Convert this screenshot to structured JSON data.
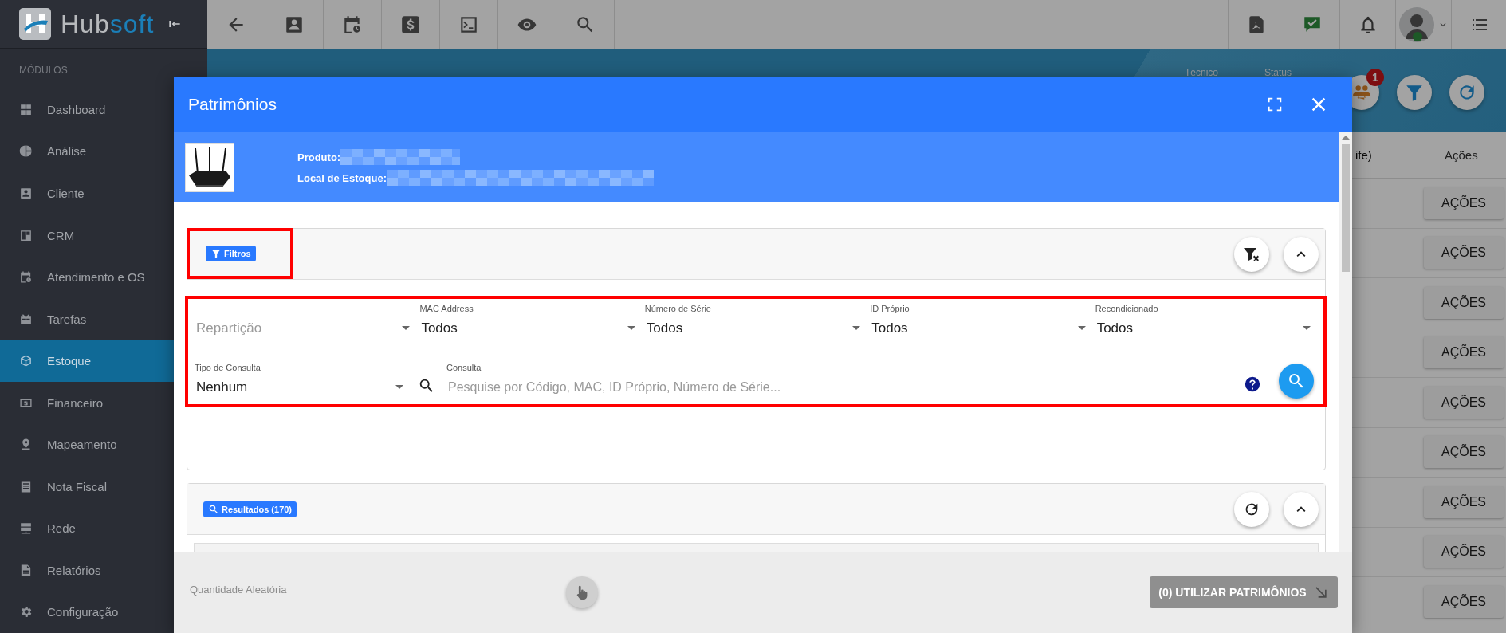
{
  "sidebar": {
    "brand": [
      "Hub",
      "soft"
    ],
    "section": "MÓDULOS",
    "items": [
      {
        "label": "Dashboard",
        "selected": false
      },
      {
        "label": "Análise",
        "selected": false
      },
      {
        "label": "Cliente",
        "selected": false
      },
      {
        "label": "CRM",
        "selected": false
      },
      {
        "label": "Atendimento e OS",
        "selected": false
      },
      {
        "label": "Tarefas",
        "selected": false
      },
      {
        "label": "Estoque",
        "selected": true
      },
      {
        "label": "Financeiro",
        "selected": false
      },
      {
        "label": "Mapeamento",
        "selected": false
      },
      {
        "label": "Nota Fiscal",
        "selected": false
      },
      {
        "label": "Rede",
        "selected": false
      },
      {
        "label": "Relatórios",
        "selected": false
      },
      {
        "label": "Configuração",
        "selected": false
      }
    ]
  },
  "page": {
    "header_labels": [
      "Técnico",
      "Status"
    ],
    "notification_badge": "1",
    "table": {
      "columns": [
        "ife)",
        "Ações"
      ],
      "rows": [
        {
          "action": "AÇÕES"
        },
        {
          "action": "AÇÕES"
        },
        {
          "action": "AÇÕES"
        },
        {
          "action": "AÇÕES"
        },
        {
          "action": "AÇÕES"
        },
        {
          "action": "AÇÕES"
        },
        {
          "action": "AÇÕES"
        },
        {
          "action": "AÇÕES"
        },
        {
          "action": "AÇÕES"
        }
      ]
    }
  },
  "modal": {
    "title": "Patrimônios",
    "product": {
      "fields": [
        {
          "label": "Produto:",
          "redacted": true
        },
        {
          "label": "Local de Estoque:",
          "redacted": true
        }
      ]
    },
    "filters": {
      "chip": "Filtros",
      "highlighted": true,
      "expanded": true,
      "form_highlighted": true,
      "row_1": [
        {
          "kind": "select",
          "placeholder": "Repartição"
        },
        {
          "kind": "select",
          "label": "MAC Address",
          "value": "Todos"
        },
        {
          "kind": "select",
          "label": "Número de Série",
          "value": "Todos"
        },
        {
          "kind": "select",
          "label": "ID Próprio",
          "value": "Todos"
        },
        {
          "kind": "select",
          "label": "Recondicionado",
          "value": "Todos"
        }
      ],
      "row_2": [
        {
          "kind": "select",
          "label": "Tipo de Consulta",
          "value": "Nenhum"
        },
        {
          "kind": "text",
          "label": "Consulta",
          "placeholder": "Pesquise por Código, MAC, ID Próprio, Número de Série..."
        }
      ]
    },
    "results": {
      "chip": "Resultados (170)",
      "expanded": true
    },
    "footer": {
      "quantity": {
        "placeholder": "Quantidade Aleatória"
      },
      "use_button": {
        "label": "(0) UTILIZAR PATRIMÔNIOS",
        "disabled": true
      }
    }
  }
}
